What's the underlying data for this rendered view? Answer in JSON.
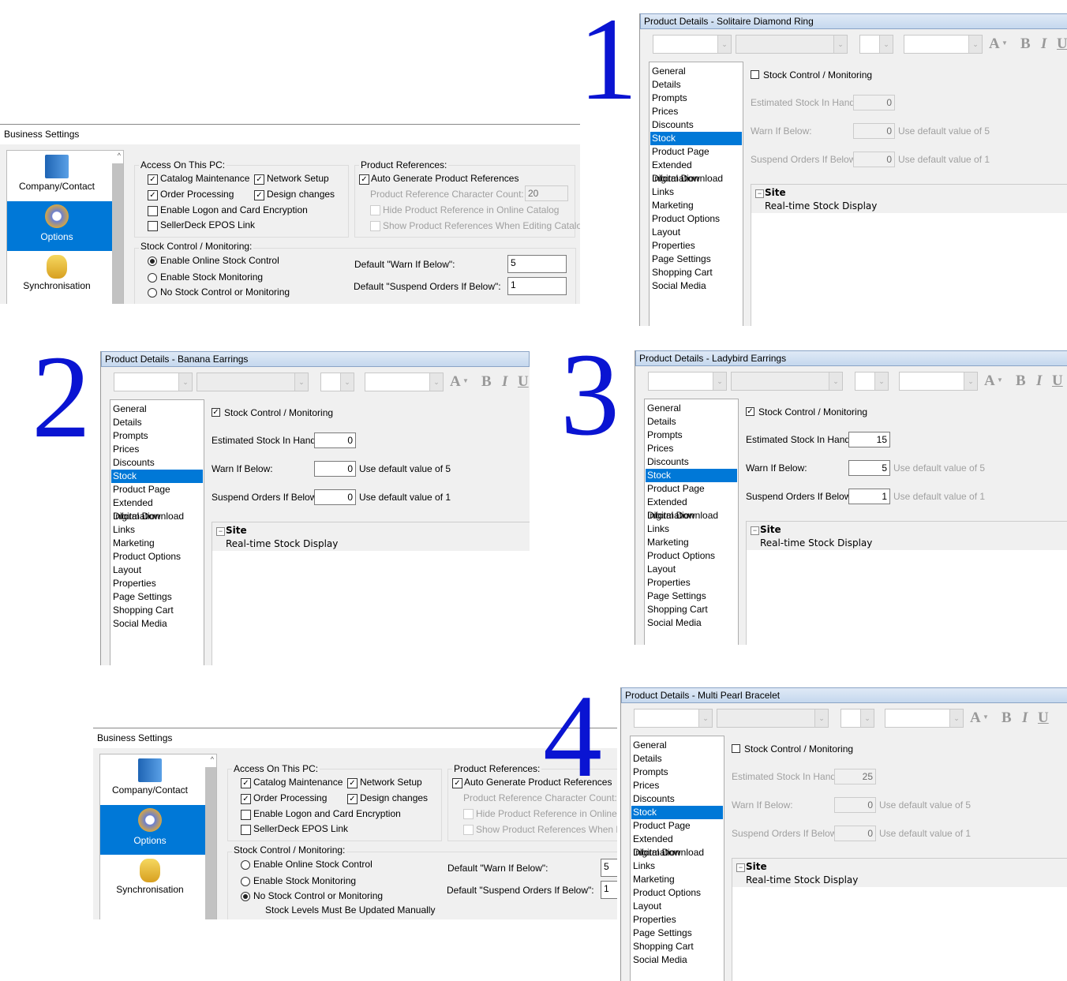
{
  "numerals": [
    "1",
    "2",
    "3",
    "4"
  ],
  "colors": {
    "selection": "#0078d7",
    "numeral": "#0a14d2",
    "titlebar": "#c5d8ee"
  },
  "product_nav_items": [
    "General",
    "Details",
    "Prompts",
    "Prices",
    "Discounts",
    "Stock",
    "Product Page",
    "Extended Information",
    "Digital Download",
    "Links",
    "Marketing",
    "Product Options",
    "Layout",
    "Properties",
    "Page Settings",
    "Shopping Cart",
    "Social Media"
  ],
  "product_nav_selected": "Stock",
  "toolbar": {
    "font_color_icon": "A",
    "bold": "B",
    "italic": "I",
    "underline": "U"
  },
  "product_labels": {
    "stock_control": "Stock Control / Monitoring",
    "estimated": "Estimated Stock In Hand:",
    "warn": "Warn If Below:",
    "suspend": "Suspend Orders If Below:",
    "site_header": "Site",
    "site_item": "Real-time Stock Display",
    "collapse_icon": "minus-box-icon"
  },
  "product_panels": [
    {
      "title": "Product Details - Solitaire Diamond Ring",
      "stock_control_checked": false,
      "estimated": "0",
      "warn": "0",
      "warn_hint": "Use default value of 5",
      "suspend": "0",
      "suspend_hint": "Use default value of 1",
      "enabled": false,
      "hint_grey": true
    },
    {
      "title": "Product Details - Banana Earrings",
      "stock_control_checked": true,
      "estimated": "0",
      "warn": "0",
      "warn_hint": "Use default value of 5",
      "suspend": "0",
      "suspend_hint": "Use default value of 1",
      "enabled": true,
      "hint_grey": false
    },
    {
      "title": "Product Details - Ladybird Earrings",
      "stock_control_checked": true,
      "estimated": "15",
      "warn": "5",
      "warn_hint": "Use default value of 5",
      "suspend": "1",
      "suspend_hint": "Use default value of 1",
      "enabled": true,
      "hint_grey": true
    },
    {
      "title": "Product Details - Multi Pearl Bracelet",
      "stock_control_checked": false,
      "estimated": "25",
      "warn": "0",
      "warn_hint": "Use default value of 5",
      "suspend": "0",
      "suspend_hint": "Use default value of 1",
      "enabled": false,
      "hint_grey": true
    }
  ],
  "business_settings_labels": {
    "title": "Business Settings",
    "sidebar": [
      "Company/Contact",
      "Options",
      "Synchronisation"
    ],
    "sidebar_selected": "Options",
    "access_group": "Access On This PC:",
    "access_items": [
      {
        "label": "Catalog Maintenance",
        "checked": true
      },
      {
        "label": "Network Setup",
        "checked": true
      },
      {
        "label": "Order Processing",
        "checked": true
      },
      {
        "label": "Design changes",
        "checked": true
      },
      {
        "label": "Enable Logon and Card Encryption",
        "checked": false
      },
      {
        "label": "SellerDeck EPOS Link",
        "checked": false
      }
    ],
    "refs_group": "Product References:",
    "auto_generate": "Auto Generate Product References",
    "char_count_label": "Product Reference Character Count:",
    "char_count": "20",
    "hide_ref": "Hide Product Reference in Online Catalog",
    "show_ref": "Show Product References When Editing Catalog",
    "stock_group": "Stock Control / Monitoring:",
    "radios": [
      "Enable Online Stock Control",
      "Enable Stock Monitoring",
      "No Stock Control  or Monitoring"
    ],
    "default_warn_label": "Default \"Warn If Below\":",
    "default_suspend_label": "Default \"Suspend Orders If Below\":"
  },
  "business_settings": [
    {
      "selected_radio": "Enable Online Stock Control",
      "default_warn": "5",
      "default_suspend": "1",
      "note": ""
    },
    {
      "selected_radio": "No Stock Control  or Monitoring",
      "default_warn": "5",
      "default_suspend": "1",
      "note": "Stock Levels Must Be Updated Manually"
    }
  ]
}
